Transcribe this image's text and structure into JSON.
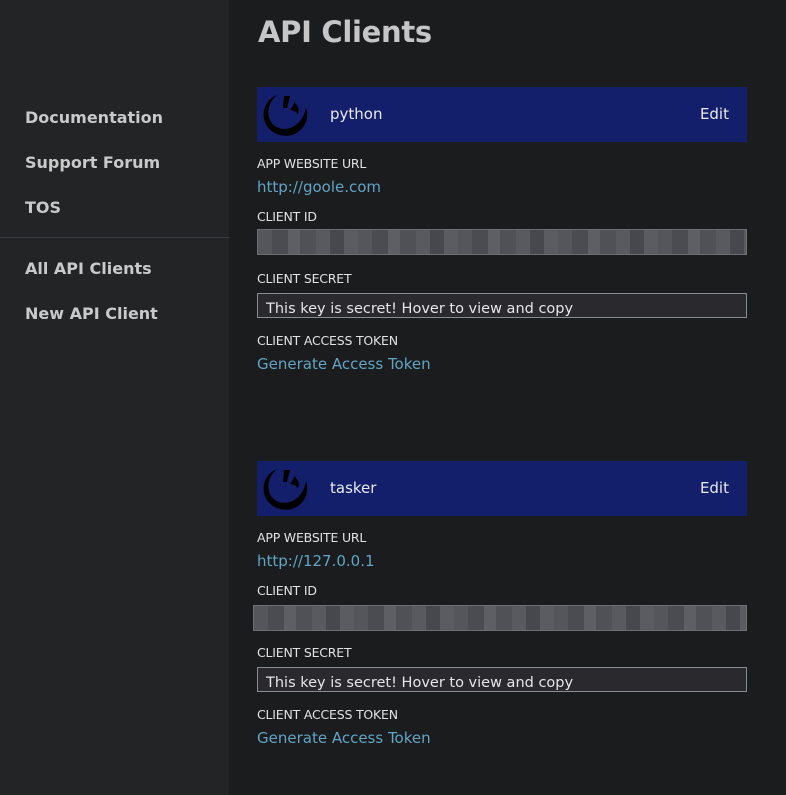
{
  "sidebar": {
    "top_links": [
      {
        "label": "Documentation"
      },
      {
        "label": "Support Forum"
      },
      {
        "label": "TOS"
      }
    ],
    "bottom_links": [
      {
        "label": "All API Clients"
      },
      {
        "label": "New API Client"
      }
    ]
  },
  "main": {
    "title": "API Clients",
    "labels": {
      "website_url": "APP WEBSITE URL",
      "client_id": "CLIENT ID",
      "client_secret": "CLIENT SECRET",
      "access_token": "CLIENT ACCESS TOKEN"
    },
    "clients": [
      {
        "name": "python",
        "edit_label": "Edit",
        "website_url": "http://goole.com",
        "secret_text": "This key is secret! Hover to view and copy",
        "token_action": "Generate Access Token"
      },
      {
        "name": "tasker",
        "edit_label": "Edit",
        "website_url": "http://127.0.0.1",
        "secret_text": "This key is secret! Hover to view and copy",
        "token_action": "Generate Access Token"
      }
    ]
  },
  "colors": {
    "background": "#1b1c1e",
    "sidebar": "#222426",
    "card_header": "#131f6b",
    "link": "#62a4c4"
  },
  "icons": {
    "client_logo": "genius-logo-icon"
  }
}
